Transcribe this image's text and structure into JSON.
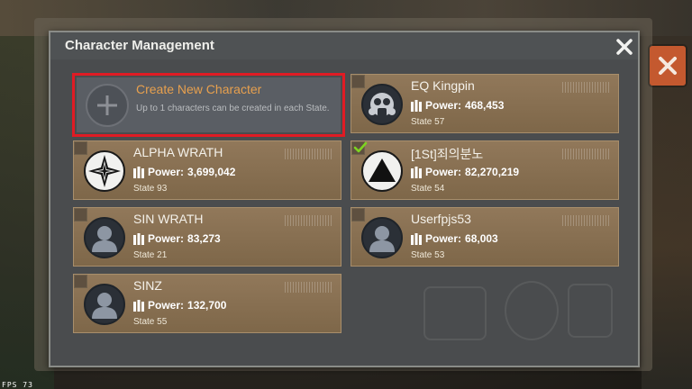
{
  "dialog": {
    "title": "Character Management"
  },
  "create": {
    "title": "Create New Character",
    "description": "Up to 1 characters can be created in each State."
  },
  "characters": [
    {
      "name": "EQ Kingpin",
      "power_label": "Power:",
      "power": "468,453",
      "state": "State 57",
      "avatar": "gas-mask-icon",
      "checked": false
    },
    {
      "name": "ALPHA WRATH",
      "power_label": "Power:",
      "power": "3,699,042",
      "state": "State 93",
      "avatar": "star-emblem-icon",
      "checked": false
    },
    {
      "name": "[1St]죄의분노",
      "power_label": "Power:",
      "power": "82,270,219",
      "state": "State 54",
      "avatar": "triangle-emblem-icon",
      "checked": true
    },
    {
      "name": "SIN WRATH",
      "power_label": "Power:",
      "power": "83,273",
      "state": "State 21",
      "avatar": "default-avatar-icon",
      "checked": false
    },
    {
      "name": "Userfpjs53",
      "power_label": "Power:",
      "power": "68,003",
      "state": "State 53",
      "avatar": "default-avatar-icon",
      "checked": false
    },
    {
      "name": "SINZ",
      "power_label": "Power:",
      "power": "132,700",
      "state": "State 55",
      "avatar": "default-avatar-icon",
      "checked": false
    }
  ],
  "hud": {
    "fps": "FPS 73"
  },
  "colors": {
    "highlight_border": "#e01b24",
    "create_title": "#e7a04e",
    "card_bg": "#8a7253",
    "check": "#7ed321",
    "outer_close_bg": "#c4592f"
  }
}
